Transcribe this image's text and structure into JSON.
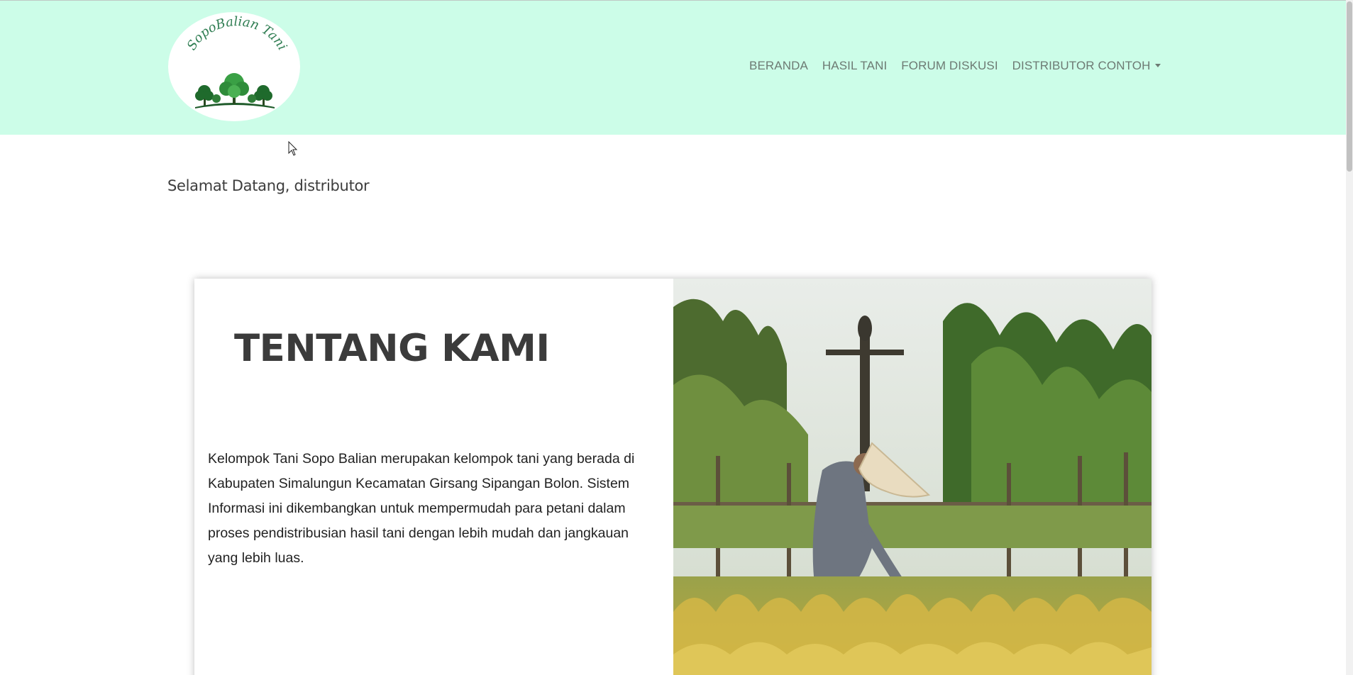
{
  "brand": {
    "logo_text": "SopoBalian Tani"
  },
  "nav": {
    "items": [
      {
        "label": "BERANDA"
      },
      {
        "label": "HASIL TANI"
      },
      {
        "label": "FORUM DISKUSI"
      },
      {
        "label": "DISTRIBUTOR CONTOH"
      }
    ]
  },
  "welcome": {
    "text": "Selamat Datang, distributor"
  },
  "about": {
    "title": "TENTANG KAMI",
    "body": "Kelompok Tani Sopo Balian merupakan kelompok tani yang berada di Kabupaten Simalungun Kecamatan Girsang Sipangan Bolon. Sistem Informasi ini dikembangkan untuk mempermudah para petani dalam proses pendistribusian hasil tani dengan lebih mudah dan jangkauan yang lebih luas."
  },
  "colors": {
    "navbar_bg": "#ccfde8",
    "nav_text": "#6d7a73",
    "title_text": "#3b3b3b"
  },
  "icons": {
    "user_menu_caret": "chevron-down-icon",
    "cursor": "mouse-pointer-icon"
  }
}
